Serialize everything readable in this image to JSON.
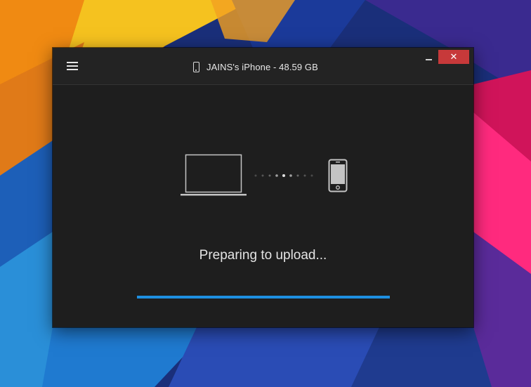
{
  "window": {
    "device_title": "JAINS's iPhone - 48.59 GB",
    "close_glyph": "✕",
    "minimize_glyph": "–"
  },
  "icons": {
    "menu": "hamburger-menu-icon",
    "title_device": "phone-icon",
    "source": "laptop-icon",
    "transfer": "transfer-dots-icon",
    "target": "iphone-icon"
  },
  "status": {
    "message": "Preparing to upload..."
  },
  "progress": {
    "fraction": 1.0,
    "color": "#1e8fe0"
  },
  "colors": {
    "window_bg": "#1e1e1e",
    "close_button": "#c7393a",
    "accent": "#1e8fe0"
  }
}
